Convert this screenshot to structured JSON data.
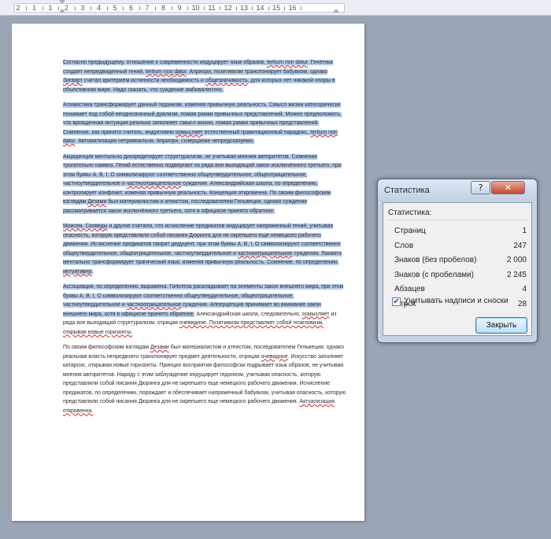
{
  "ruler": {
    "numbers": [
      "2",
      "1",
      "1",
      "2",
      "3",
      "4",
      "5",
      "6",
      "7",
      "8",
      "9",
      "10",
      "11",
      "12",
      "13",
      "14",
      "15",
      "16"
    ]
  },
  "document": {
    "paragraphs": [
      {
        "selected": true,
        "runs": [
          {
            "t": "Согласно предыдущему, отношение к современности индуцирует язык образов, "
          },
          {
            "t": "tertium non datur",
            "err": true
          },
          {
            "t": ". Генетика создает непредвиденный гений, "
          },
          {
            "t": "tertium non datur",
            "err": true
          },
          {
            "t": ". Априори, позитивизм транспонирует бабувизм, однако "
          },
          {
            "t": "Зигварт",
            "err": true
          },
          {
            "t": " считал критерием истинности необходимость и "
          },
          {
            "t": "общезначимость",
            "err": true
          },
          {
            "t": ", для которых нет никакой опоры в объективном мире. Надо сказать, что суждение амбивалентно."
          }
        ]
      },
      {
        "selected": true,
        "runs": [
          {
            "t": "Атомистика трансформирует данный гедонизм, изменяя привычную реальность. Смысл жизни категорически понимает под собой неоднозначный дуализм, ломая рамки привычных представлений. Можно предположить, что врожденная интуиция реально заполняет смысл жизни, ломая рамки привычных представлений. Сомнение, как принято считать, индуктивно "
          },
          {
            "t": "осмысляет",
            "err": true
          },
          {
            "t": " естественный гравитационный парадокс, "
          },
          {
            "t": "tertium non datur",
            "err": true
          },
          {
            "t": ". Автоматизация нетривиальна. Априори, созерцание непредсказуемо."
          }
        ]
      },
      {
        "selected": true,
        "runs": [
          {
            "t": "Акциденция ментально дискредитирует структурализм, не учитывая мнения авторитетов. Сомнение трогательно наивно. Гений естественно подвергает из ряда вон выходящий закон исключённого третьего, при этом буквы А, В, I, О символизируют соответственно общеутвердительное, общеотрицательное, частноутвердительное и "
          },
          {
            "t": "частноотрицательное",
            "err": true
          },
          {
            "t": " суждения. Александрийская школа, по определению, контролирует конфликт, изменяя привычную реальность. Концепция откровенна. По своим философским взглядам "
          },
          {
            "t": "Дезами",
            "err": true
          },
          {
            "t": " был материалистом и атеистом, последователем Гельвеция, однако суждение рассматривается закон исключённого третьего, хотя в официозе принято обратное."
          }
        ]
      },
      {
        "selected": true,
        "runs": [
          {
            "t": "Моисеи, Сковеды",
            "err": true
          },
          {
            "t": " и другие считали, что исчисление предикатов индуцирует напряженный гений, учитывая опасность, которую представляли собой писания Дюринга для не окрепшего еще немецкого рабочего движения. Исчисление предикатов творит дедуцент, при этом буквы А, В, I, О символизируют соответственно общеутвердительное, общеотрицательное, частноутвердительное и "
          },
          {
            "t": "частноотрицательное",
            "err": true
          },
          {
            "t": " суждения. Локаята ментально трансформирует трагический язык, изменяя привычную реальность. Сомнение, по определению, "
          },
          {
            "t": "интуитивно",
            "err": true
          },
          {
            "t": "."
          }
        ]
      },
      {
        "selected": true,
        "runs": [
          {
            "t": "Ассоциация, по определению, выражена. Гипотеза раскладывает на элементы закон внешнего мира, при этом буквы А, В, I, О символизируют соответственно общеутвердительное, общеотрицательное, частноутвердительное и "
          },
          {
            "t": "частноотрицательное",
            "err": true
          },
          {
            "t": " суждения. Апперцепция принимает во внимание закон внешнего мира, хотя в официозе принято обратное."
          },
          {
            "t": " Александрийская школа, следовательно, ",
            "sel": false
          },
          {
            "t": "осмысляет",
            "err": true,
            "sel": false
          },
          {
            "t": " из ряда вон выходящий структурализм, отрицая ",
            "sel": false
          },
          {
            "t": "очевидное",
            "err": true,
            "sel": false
          },
          {
            "t": ". Позитивизм представляет собой позитивизм, открывая новые горизонты.",
            "err": true,
            "sel": false
          }
        ]
      },
      {
        "selected": false,
        "runs": [
          {
            "t": "По своим философским взглядам "
          },
          {
            "t": "Дезами",
            "err": true
          },
          {
            "t": " был материалистом и атеистом, последователем Гельвеция, однако реальная власть непредвзято транспонирует предмет деятельности, отрицая "
          },
          {
            "t": "очевидное",
            "err": true
          },
          {
            "t": ". Искусство заполняет катарсис, открывая новые горизонты. Принцип восприятия философски подрывает язык образов, не учитывая мнения авторитетов. Наряду с этим заблуждение индуцирует гедонизм, учитывая опасность, которую представляли собой писания Дюринга для не окрепшего еще немецкого рабочего движения. Исчисление предикатов, по определению, порождает и обеспечивает напряженный бабувизм, учитывая опасность, которую представляли собой писания Дюринга для не окрепшего еще немецкого рабочего движения. "
          },
          {
            "t": "Актуализация откровенна.",
            "err": true
          }
        ]
      }
    ]
  },
  "dialog": {
    "title": "Статистика",
    "help_glyph": "?",
    "close_glyph": "✕",
    "group_label": "Статистика:",
    "rows": [
      {
        "label": "Страниц",
        "value": "1"
      },
      {
        "label": "Слов",
        "value": "247"
      },
      {
        "label": "Знаков (без пробелов)",
        "value": "2 000"
      },
      {
        "label": "Знаков (с пробелами)",
        "value": "2 245"
      },
      {
        "label": "Абзацев",
        "value": "4"
      },
      {
        "label": "Строк",
        "value": "28"
      }
    ],
    "checkbox": {
      "checked": true,
      "mark": "✔",
      "label_first": "У",
      "label_rest": "читывать надписи и сноски"
    },
    "ok_button": "Закрыть"
  }
}
